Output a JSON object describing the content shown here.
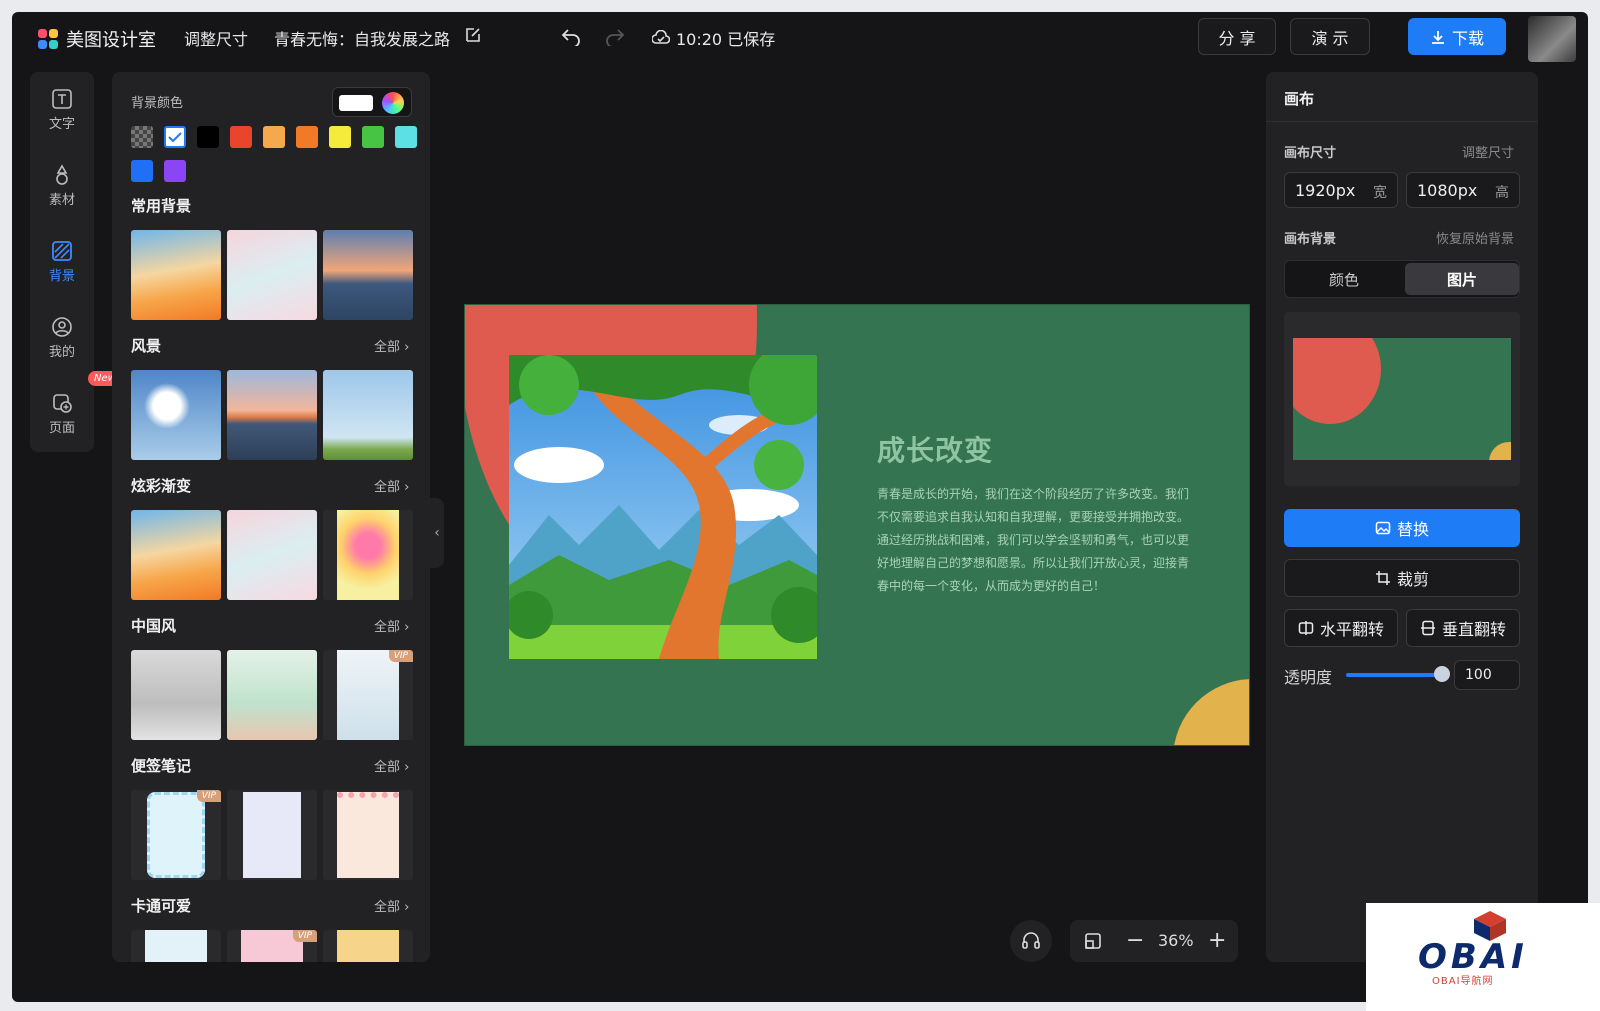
{
  "app": {
    "name": "美图设计室",
    "resize_label": "调整尺寸",
    "doc_title": "青春无悔：自我发展之路",
    "save_status": "10:20 已保存",
    "share_label": "分 享",
    "present_label": "演 示",
    "download_label": "下载"
  },
  "rail": {
    "items": [
      {
        "label": "文字",
        "icon": "text-icon"
      },
      {
        "label": "素材",
        "icon": "shapes-icon"
      },
      {
        "label": "背景",
        "icon": "background-icon",
        "active": true
      },
      {
        "label": "我的",
        "icon": "user-icon"
      },
      {
        "label": "页面",
        "icon": "page-add-icon"
      }
    ],
    "new_badge": "New"
  },
  "panel": {
    "bg_color_label": "背景颜色",
    "swatches": [
      "transparent",
      "#ffffff",
      "#000000",
      "#e8452c",
      "#f5a94f",
      "#f27a26",
      "#f5eb3a",
      "#48c445",
      "#5ce0e6",
      "#1f6ff7",
      "#8a46f5"
    ],
    "more_label": "全部",
    "vip_label": "VIP",
    "sections": [
      {
        "title": "常用背景"
      },
      {
        "title": "风景"
      },
      {
        "title": "炫彩渐变"
      },
      {
        "title": "中国风"
      },
      {
        "title": "便签笔记"
      },
      {
        "title": "卡通可爱"
      }
    ]
  },
  "slide": {
    "title": "成长改变",
    "body": "青春是成长的开始，我们在这个阶段经历了许多改变。我们不仅需要追求自我认知和自我理解，更要接受并拥抱改变。通过经历挑战和困难，我们可以学会坚韧和勇气，也可以更好地理解自己的梦想和愿景。所以让我们开放心灵，迎接青春中的每一个变化，从而成为更好的自己！"
  },
  "zoom": {
    "value": "36%"
  },
  "right_panel": {
    "title": "画布",
    "canvas_size_label": "画布尺寸",
    "resize_link": "调整尺寸",
    "width_value": "1920px",
    "width_unit": "宽",
    "height_value": "1080px",
    "height_unit": "高",
    "canvas_bg_label": "画布背景",
    "restore_link": "恢复原始背景",
    "tab_color": "颜色",
    "tab_image": "图片",
    "replace_label": "替换",
    "crop_label": "裁剪",
    "flip_h_label": "水平翻转",
    "flip_v_label": "垂直翻转",
    "opacity_label": "透明度",
    "opacity_value": "100"
  },
  "watermark": {
    "text": "OBAI",
    "sub": "OBAI导航网"
  },
  "colors": {
    "accent": "#1f7cf7",
    "slide_bg": "#357450",
    "slide_red": "#df5b4f",
    "slide_yellow": "#e2b24d"
  }
}
